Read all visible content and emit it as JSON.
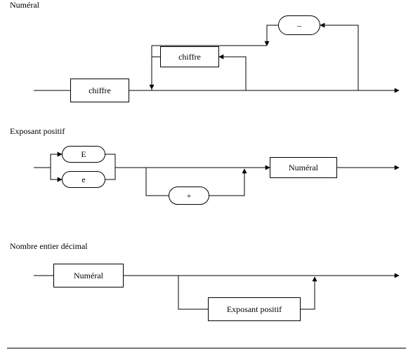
{
  "diagram1": {
    "title": "Numéral",
    "node_chiffre_main": "chiffre",
    "node_chiffre_loop": "chiffre",
    "node_minus": "–"
  },
  "diagram2": {
    "title": "Exposant positif",
    "node_E": "E",
    "node_e": "e",
    "node_plus": "+",
    "node_numeral": "Numéral"
  },
  "diagram3": {
    "title": "Nombre entier décimal",
    "node_numeral": "Numéral",
    "node_exposant": "Exposant positif"
  }
}
